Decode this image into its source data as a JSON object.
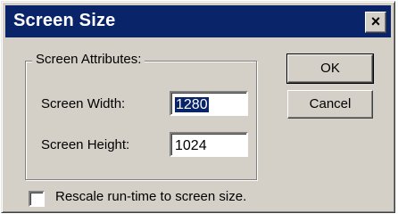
{
  "window": {
    "title": "Screen Size",
    "close_glyph": "×"
  },
  "group": {
    "label": "Screen Attributes:",
    "width_label": "Screen Width:",
    "width_value": "1280",
    "height_label": "Screen Height:",
    "height_value": "1024"
  },
  "buttons": {
    "ok": "OK",
    "cancel": "Cancel"
  },
  "option": {
    "label": "Rescale run-time to screen size.",
    "checked": false
  },
  "colors": {
    "titlebar": "#0a246a",
    "face": "#d4d0c8",
    "selection": "#0a246a"
  }
}
